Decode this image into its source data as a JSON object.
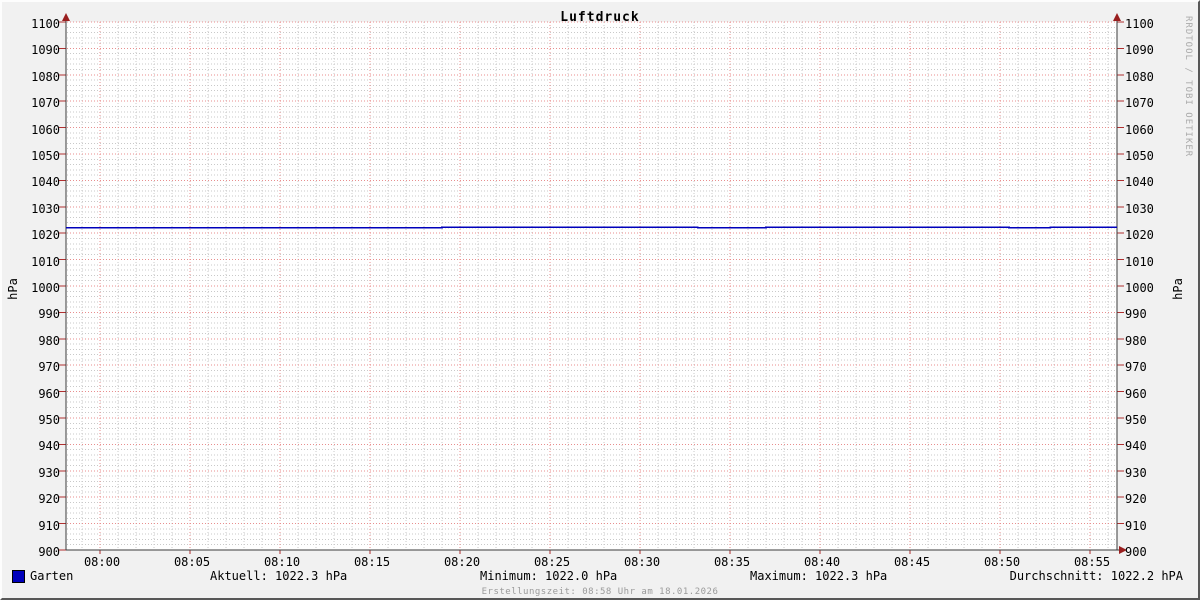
{
  "title": "Luftdruck",
  "watermark": "RRDTOOL / TOBI OETIKER",
  "y_axis": {
    "unit_left": "hPa",
    "unit_right": "hPa"
  },
  "legend": {
    "series_label": "Garten",
    "swatch_color": "#0000bb",
    "aktuell": "Aktuell: 1022.3 hPa",
    "minimum": "Minimum: 1022.0 hPa",
    "maximum": "Maximum: 1022.3 hPa",
    "durchschnitt": "Durchschnitt: 1022.2 hPA"
  },
  "footer": {
    "created": "Erstellungszeit: 08:58 Uhr am 18.01.2026"
  },
  "colors": {
    "background": "#f1f1f1",
    "canvas": "#ffffff",
    "major_grid": "#e88e8e",
    "minor_grid": "#c9c9c9",
    "axis": "#3a3a3a",
    "tick": "#b03030",
    "arrow": "#991f1f",
    "line": "#0000bb",
    "muted_text": "#9a9a9a"
  },
  "chart_data": {
    "type": "line",
    "title": "Luftdruck",
    "xlabel": "",
    "ylabel": "hPa",
    "ylim": [
      900,
      1100
    ],
    "y_major_step": 10,
    "y_minor_step": 2,
    "x_ticks": [
      "08:00",
      "08:05",
      "08:10",
      "08:15",
      "08:20",
      "08:25",
      "08:30",
      "08:35",
      "08:40",
      "08:45",
      "08:50",
      "08:55"
    ],
    "x_tick_step_minutes": 5,
    "x_minor_step_minutes": 1,
    "x_range_minutes": [
      -1.9,
      56.5
    ],
    "grid": true,
    "legend_position": "bottom",
    "series": [
      {
        "name": "Garten",
        "color": "#0000bb",
        "segments": [
          {
            "from_min": -1.9,
            "to_min": 19.0,
            "value": 1022.0
          },
          {
            "from_min": 19.0,
            "to_min": 33.2,
            "value": 1022.3
          },
          {
            "from_min": 33.2,
            "to_min": 37.0,
            "value": 1022.0
          },
          {
            "from_min": 37.0,
            "to_min": 50.5,
            "value": 1022.3
          },
          {
            "from_min": 50.5,
            "to_min": 52.8,
            "value": 1022.0
          },
          {
            "from_min": 52.8,
            "to_min": 56.5,
            "value": 1022.3
          }
        ]
      }
    ],
    "stats": {
      "aktuell": 1022.3,
      "minimum": 1022.0,
      "maximum": 1022.3,
      "durchschnitt": 1022.2
    }
  }
}
